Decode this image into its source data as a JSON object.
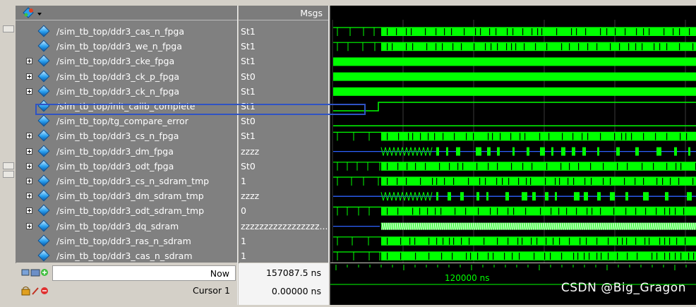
{
  "header": {
    "msgs_title": "Msgs"
  },
  "signals": [
    {
      "name": "/sim_tb_top/ddr3_cas_n_fpga",
      "value": "St1",
      "expandable": false,
      "wave": "pulse"
    },
    {
      "name": "/sim_tb_top/ddr3_we_n_fpga",
      "value": "St1",
      "expandable": false,
      "wave": "pulse"
    },
    {
      "name": "/sim_tb_top/ddr3_cke_fpga",
      "value": "St1",
      "expandable": true,
      "wave": "high"
    },
    {
      "name": "/sim_tb_top/ddr3_ck_p_fpga",
      "value": "St0",
      "expandable": true,
      "wave": "clock"
    },
    {
      "name": "/sim_tb_top/ddr3_ck_n_fpga",
      "value": "St1",
      "expandable": true,
      "wave": "clock"
    },
    {
      "name": "/sim_tb_top/init_calib_complete",
      "value": "St1",
      "expandable": false,
      "wave": "step"
    },
    {
      "name": "/sim_tb_top/tg_compare_error",
      "value": "St0",
      "expandable": false,
      "wave": "low"
    },
    {
      "name": "/sim_tb_top/ddr3_cs_n_fpga",
      "value": "St1",
      "expandable": true,
      "wave": "pulse"
    },
    {
      "name": "/sim_tb_top/ddr3_dm_fpga",
      "value": "zzzz",
      "expandable": true,
      "wave": "bus"
    },
    {
      "name": "/sim_tb_top/ddr3_odt_fpga",
      "value": "St0",
      "expandable": true,
      "wave": "pulse"
    },
    {
      "name": "/sim_tb_top/ddr3_cs_n_sdram_tmp",
      "value": "1",
      "expandable": true,
      "wave": "pulse"
    },
    {
      "name": "/sim_tb_top/ddr3_dm_sdram_tmp",
      "value": "zzzz",
      "expandable": true,
      "wave": "bus"
    },
    {
      "name": "/sim_tb_top/ddr3_odt_sdram_tmp",
      "value": "0",
      "expandable": true,
      "wave": "pulse"
    },
    {
      "name": "/sim_tb_top/ddr3_dq_sdram",
      "value": "zzzzzzzzzzzzzzzzz...",
      "expandable": true,
      "wave": "dq"
    },
    {
      "name": "/sim_tb_top/ddr3_ras_n_sdram",
      "value": "1",
      "expandable": false,
      "wave": "pulse"
    },
    {
      "name": "/sim_tb_top/ddr3_cas_n_sdram",
      "value": "1",
      "expandable": false,
      "wave": "pulse"
    }
  ],
  "footer": {
    "now_label": "Now",
    "now_value": "157087.5 ns",
    "cursor_label": "Cursor 1",
    "cursor_value": "0.00000 ns",
    "timeline_label": "120000 ns"
  },
  "watermark": "CSDN @Big_Gragon",
  "colors": {
    "wave": "#00ff00",
    "bus_line": "#2d62ff",
    "background": "#000000",
    "selection": "#2f53c4"
  }
}
